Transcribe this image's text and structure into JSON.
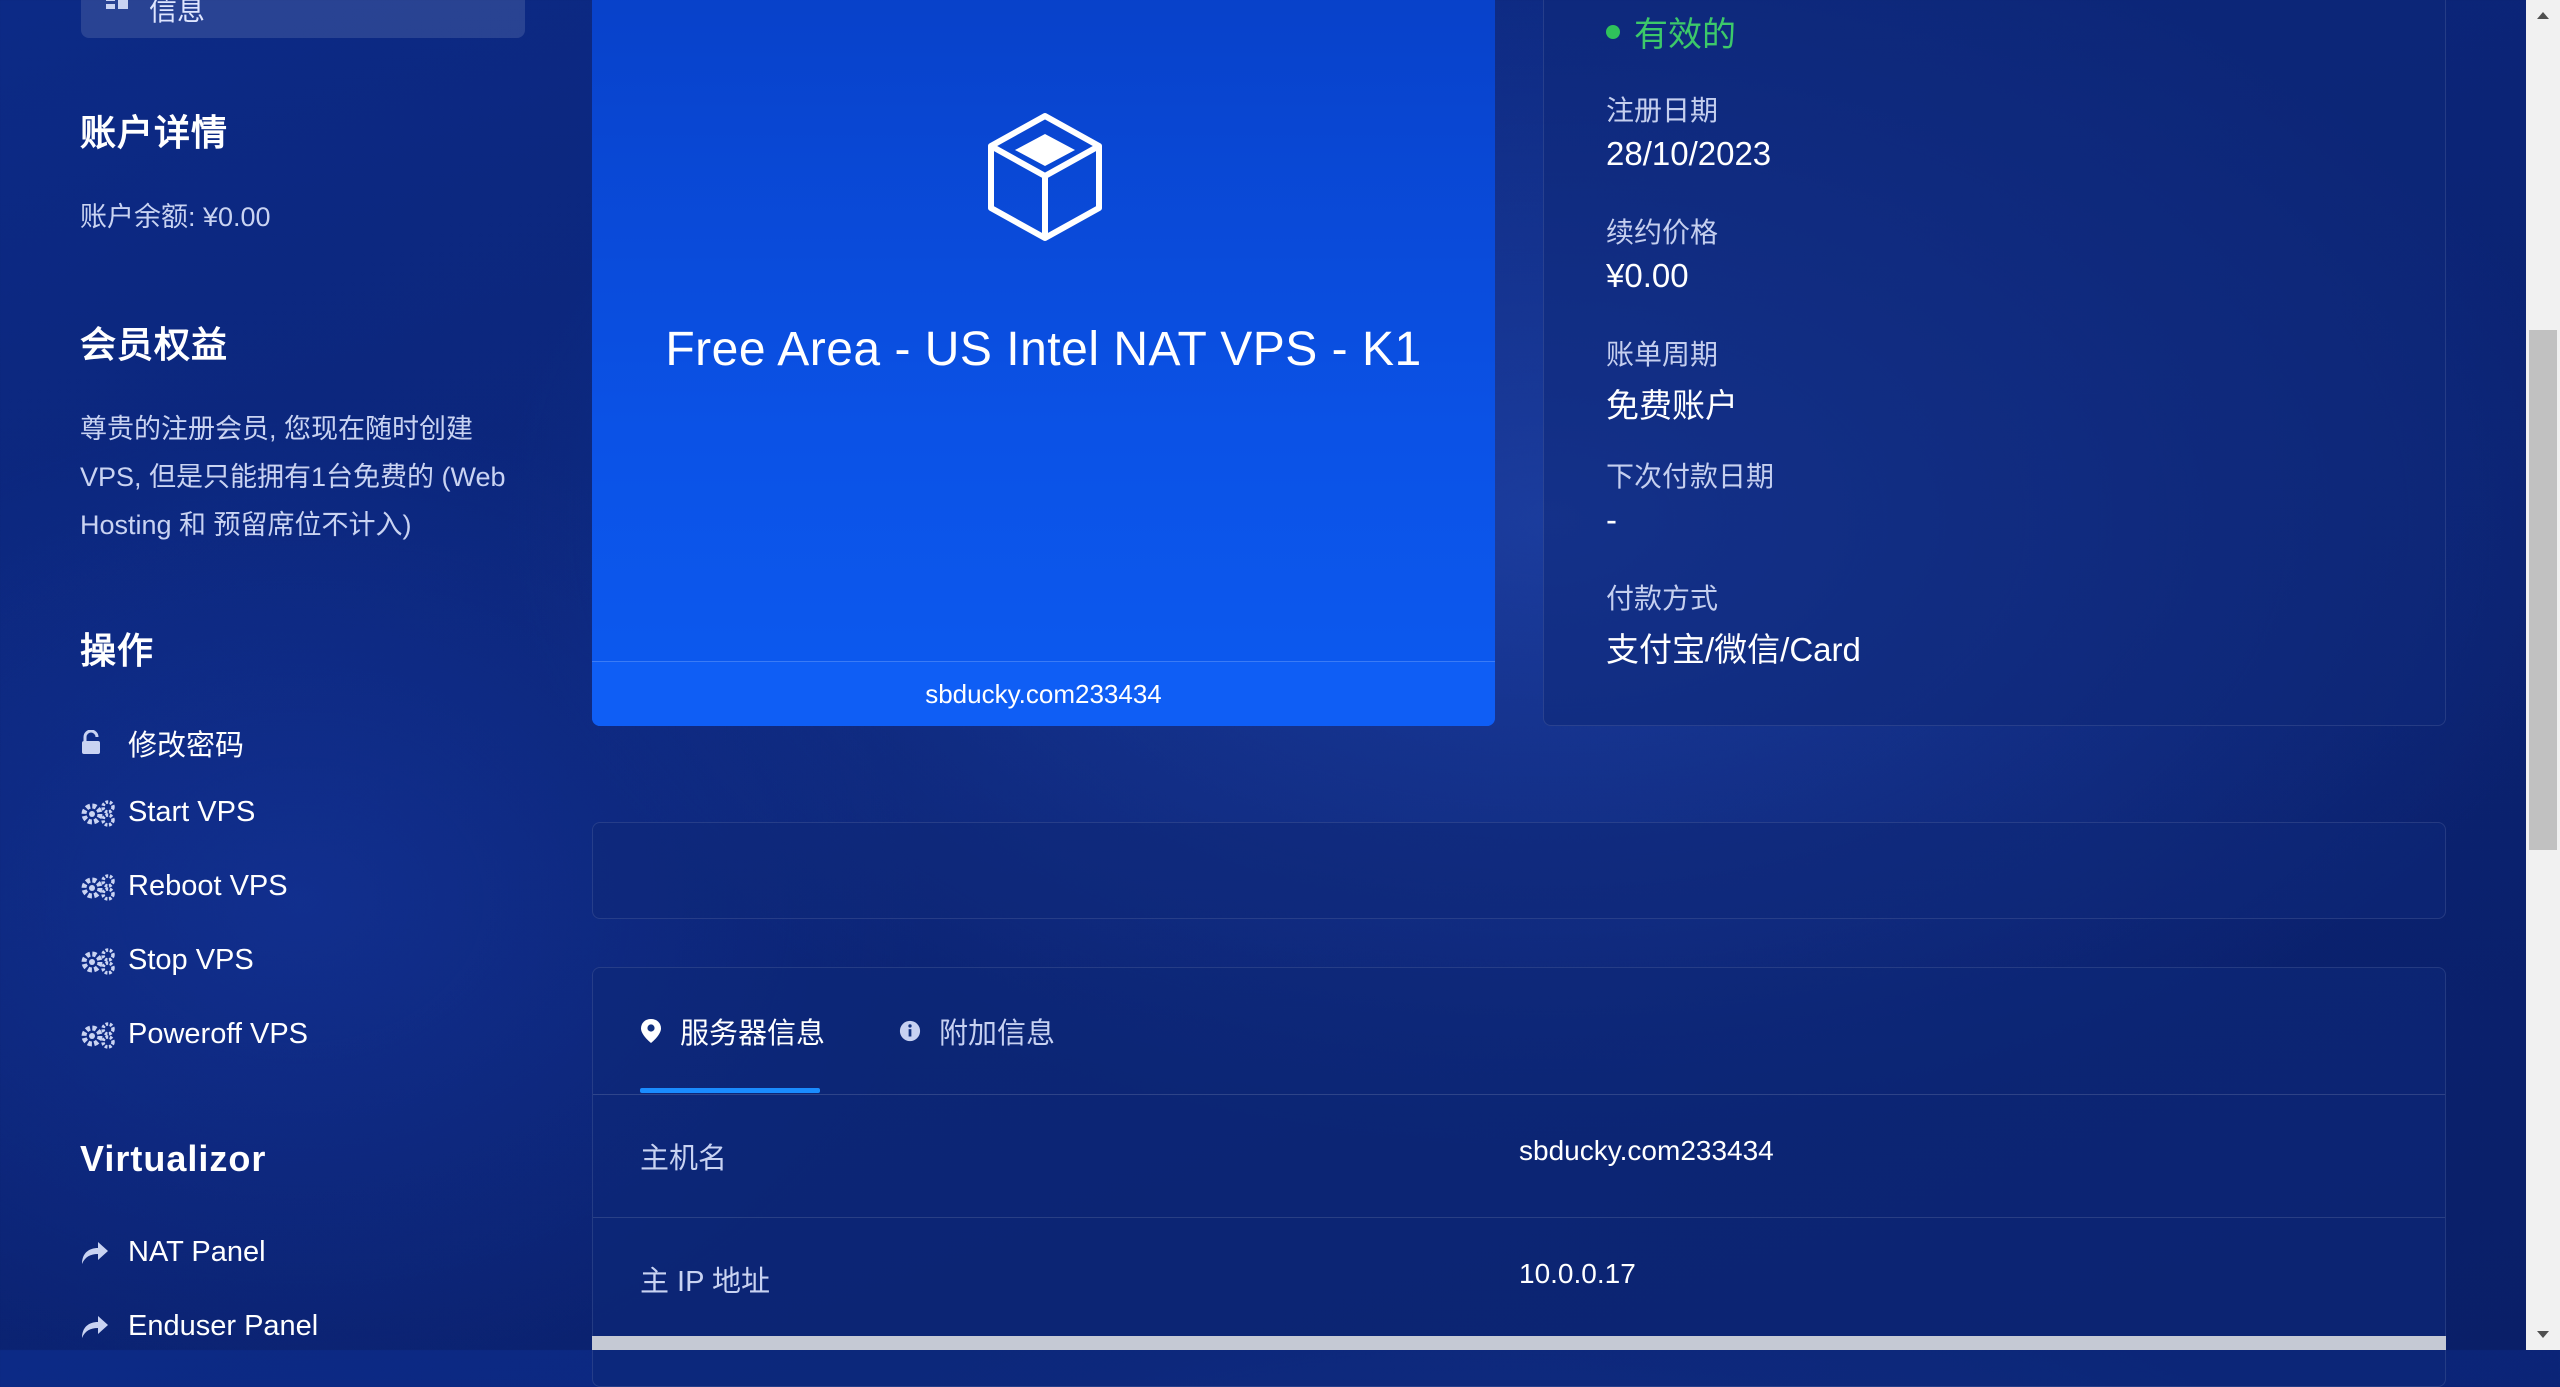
{
  "sidebar": {
    "top_button_label": "信息",
    "account_heading": "账户详情",
    "balance_text": "账户余额: ¥0.00",
    "membership_heading": "会员权益",
    "membership_text": "尊贵的注册会员, 您现在随时创建VPS, 但是只能拥有1台免费的 (Web Hosting 和 预留席位不计入)",
    "actions_heading": "操作",
    "actions": [
      {
        "label": "修改密码",
        "icon": "lock-icon"
      },
      {
        "label": "Start VPS",
        "icon": "gears-icon"
      },
      {
        "label": "Reboot VPS",
        "icon": "gears-icon"
      },
      {
        "label": "Stop VPS",
        "icon": "gears-icon"
      },
      {
        "label": "Poweroff VPS",
        "icon": "gears-icon"
      }
    ],
    "virtualizor_heading": "Virtualizor",
    "virtualizor_links": [
      {
        "label": "NAT Panel",
        "icon": "share-arrow-icon"
      },
      {
        "label": "Enduser Panel",
        "icon": "share-arrow-icon"
      }
    ]
  },
  "product": {
    "icon": "cube-icon",
    "name": "Free Area - US Intel NAT VPS - K1",
    "hostname": "sbducky.com233434"
  },
  "billing": {
    "status": "有效的",
    "status_color": "#2fc25b",
    "registered_label": "注册日期",
    "registered_value": "28/10/2023",
    "renewal_price_label": "续约价格",
    "renewal_price_value": "¥0.00",
    "billing_cycle_label": "账单周期",
    "billing_cycle_value": "免费账户",
    "next_due_label": "下次付款日期",
    "next_due_value": "-",
    "payment_method_label": "付款方式",
    "payment_method_value": "支付宝/微信/Card"
  },
  "tabs": [
    {
      "label": "服务器信息",
      "icon": "map-pin-icon",
      "active": true
    },
    {
      "label": "附加信息",
      "icon": "info-circle-icon",
      "active": false
    }
  ],
  "server_info": [
    {
      "key": "主机名",
      "value": "sbducky.com233434"
    },
    {
      "key": "主 IP 地址",
      "value": "10.0.0.17"
    }
  ],
  "colors": {
    "accent": "#1a8cff",
    "product_card": "#0b52e6",
    "background": "#0b2476"
  }
}
